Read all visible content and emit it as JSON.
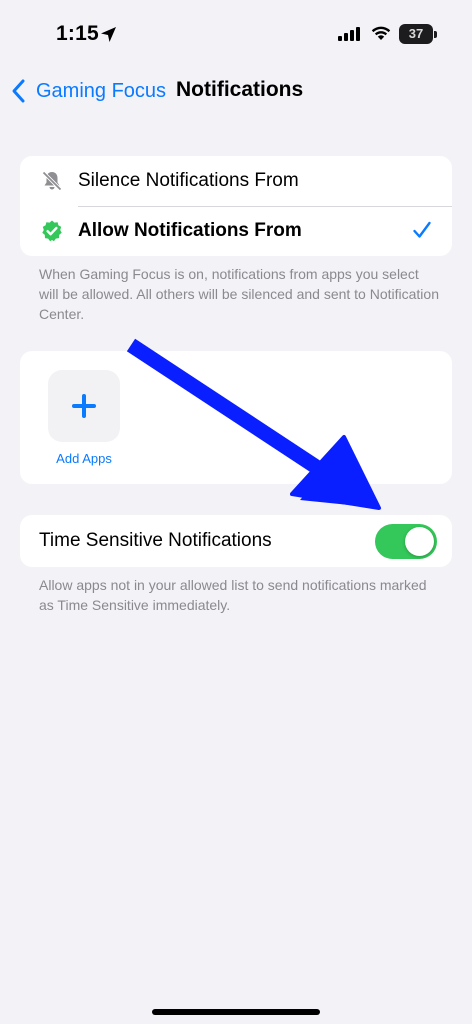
{
  "status_bar": {
    "time": "1:15",
    "battery": "37",
    "icons": [
      "location-arrow-icon",
      "cellular-signal-icon",
      "wifi-icon",
      "battery-icon"
    ]
  },
  "nav": {
    "back_label": "Gaming Focus",
    "title": "Notifications"
  },
  "options": [
    {
      "label": "Silence Notifications From",
      "icon": "bell-slash-icon",
      "selected": false
    },
    {
      "label": "Allow Notifications From",
      "icon": "checkmark-seal-icon",
      "selected": true
    }
  ],
  "options_footnote": "When Gaming Focus is on, notifications from apps you select will be allowed. All others will be silenced and sent to Notification Center.",
  "apps": {
    "add_label": "Add Apps"
  },
  "time_sensitive": {
    "label": "Time Sensitive Notifications",
    "enabled": true,
    "footnote": "Allow apps not in your allowed list to send notifications marked as Time Sensitive immediately."
  },
  "colors": {
    "accent": "#0a7aff",
    "toggle_on": "#34c759",
    "annotation_arrow": "#0a1fff",
    "background": "#f2f2f7"
  }
}
